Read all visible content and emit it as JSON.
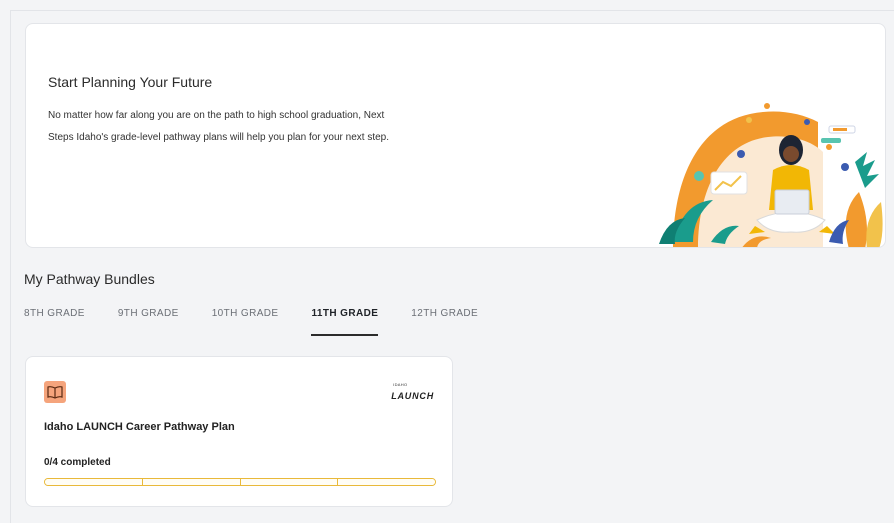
{
  "hero": {
    "title": "Start Planning Your Future",
    "text": "No matter how far along you are on the path to high school graduation, Next Steps Idaho's grade-level pathway plans will help you plan for your next step.",
    "illustration": "student-with-laptop-illustration"
  },
  "bundles": {
    "title": "My Pathway Bundles",
    "tabs": [
      {
        "label": "8TH GRADE",
        "active": false
      },
      {
        "label": "9TH GRADE",
        "active": false
      },
      {
        "label": "10TH GRADE",
        "active": false
      },
      {
        "label": "11TH GRADE",
        "active": true
      },
      {
        "label": "12TH GRADE",
        "active": false
      }
    ]
  },
  "card": {
    "icon": "book-icon",
    "logo_small": "IDAHO",
    "logo_big": "LAUNCH",
    "title": "Idaho LAUNCH Career Pathway Plan",
    "progress_text": "0/4 completed",
    "completed": 0,
    "total": 4
  },
  "colors": {
    "page_bg": "#f3f4f6",
    "card_bg": "#ffffff",
    "book_badge": "#f5a47c",
    "progress_border": "#e9b93a",
    "active_tab_underline": "#2b2b2b"
  }
}
